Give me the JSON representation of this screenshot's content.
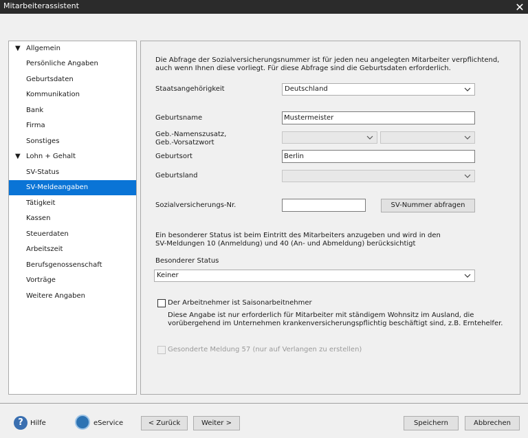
{
  "window": {
    "title": "Mitarbeiterassistent",
    "close_glyph": "✕"
  },
  "nav": {
    "groups": [
      {
        "label": "Allgemein",
        "items": [
          "Persönliche Angaben",
          "Geburtsdaten",
          "Kommunikation",
          "Bank",
          "Firma",
          "Sonstiges"
        ]
      },
      {
        "label": "Lohn + Gehalt",
        "items": [
          "SV-Status",
          "SV-Meldeangaben",
          "Tätigkeit",
          "Kassen",
          "Steuerdaten",
          "Arbeitszeit",
          "Berufsgenossenschaft",
          "Vorträge",
          "Weitere Angaben"
        ]
      }
    ],
    "selected": "SV-Meldeangaben"
  },
  "form": {
    "intro_line1": "Die Abfrage der Sozialversicherungsnummer ist für jeden neu angelegten Mitarbeiter verpflichtend,",
    "intro_line2": "auch wenn Ihnen diese vorliegt. Für diese Abfrage sind die Geburtsdaten erforderlich.",
    "staatsangehoerigkeit_label": "Staatsangehörigkeit",
    "staatsangehoerigkeit_value": "Deutschland",
    "geburtsname_label": "Geburtsname",
    "geburtsname_value": "Mustermeister",
    "namenszusatz_label1": "Geb.-Namenszusatz,",
    "namenszusatz_label2": "Geb.-Vorsatzwort",
    "geburtsort_label": "Geburtsort",
    "geburtsort_value": "Berlin",
    "geburtsland_label": "Geburtsland",
    "svnr_label": "Sozialversicherungs-Nr.",
    "svnr_value": "",
    "svnr_button": "SV-Nummer abfragen",
    "status_info_line1": "Ein besonderer Status ist beim Eintritt des Mitarbeiters anzugeben und wird in den",
    "status_info_line2": "SV-Meldungen 10 (Anmeldung) und 40 (An- und Abmeldung) berücksichtigt",
    "status_label": "Besonderer Status",
    "status_value": "Keiner",
    "saison_label": "Der Arbeitnehmer ist Saisonarbeitnehmer",
    "saison_checked": false,
    "saison_info_line1": "Diese Angabe ist nur erforderlich für Mitarbeiter mit ständigem Wohnsitz im Ausland, die",
    "saison_info_line2": "vorübergehend im Unternehmen krankenversicherungspflichtig beschäftigt sind, z.B. Erntehelfer.",
    "meldung57_label": "Gesonderte Meldung 57 (nur auf Verlangen zu erstellen)",
    "meldung57_checked": false
  },
  "footer": {
    "help": "Hilfe",
    "eservice": "eService",
    "back": "< Zurück",
    "next": "Weiter >",
    "save": "Speichern",
    "cancel": "Abbrechen"
  }
}
